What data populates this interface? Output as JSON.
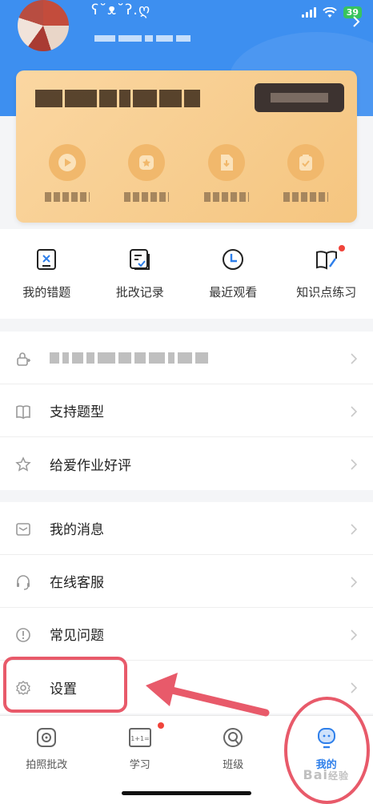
{
  "status_bar": {
    "battery": "39"
  },
  "profile": {
    "username": "ʕ˘ᴥ˘ʔ.ღ"
  },
  "quick_actions": [
    {
      "label": "我的错题",
      "icon": "mistakes-icon"
    },
    {
      "label": "批改记录",
      "icon": "correction-record-icon"
    },
    {
      "label": "最近观看",
      "icon": "recent-watch-icon"
    },
    {
      "label": "知识点练习",
      "icon": "knowledge-practice-icon",
      "badge": true
    }
  ],
  "menu_group_1": [
    {
      "label": "",
      "icon": "lock-user-icon",
      "masked": true
    },
    {
      "label": "支持题型",
      "icon": "book-icon"
    },
    {
      "label": "给爱作业好评",
      "icon": "star-icon"
    }
  ],
  "menu_group_2": [
    {
      "label": "我的消息",
      "icon": "message-icon"
    },
    {
      "label": "在线客服",
      "icon": "headset-icon"
    },
    {
      "label": "常见问题",
      "icon": "question-icon"
    },
    {
      "label": "设置",
      "icon": "settings-icon"
    }
  ],
  "tabs": [
    {
      "label": "拍照批改",
      "icon": "camera-icon",
      "active": false
    },
    {
      "label": "学习",
      "icon": "study-icon",
      "active": false,
      "badge": true
    },
    {
      "label": "班级",
      "icon": "class-icon",
      "active": false
    },
    {
      "label": "我的",
      "icon": "profile-icon",
      "active": true
    }
  ],
  "colors": {
    "primary": "#3d8ff0",
    "active_tab": "#2e7fea",
    "annotation": "#e85a6a",
    "vip_card": "#f7cd8f"
  }
}
